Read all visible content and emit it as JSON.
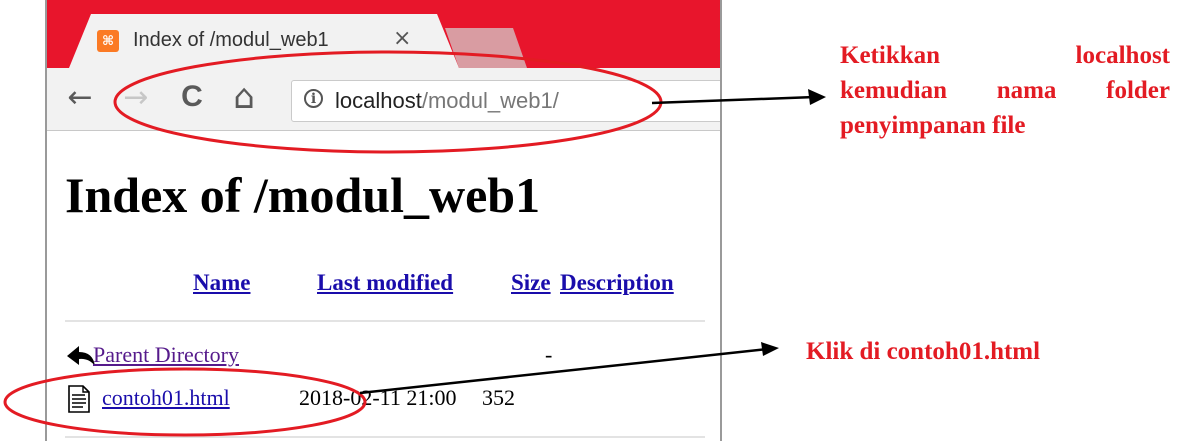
{
  "browser": {
    "tab": {
      "favicon_text": "⌘",
      "title": "Index of /modul_web1",
      "close_glyph": "×"
    },
    "toolbar": {
      "back_glyph": "←",
      "forward_glyph": "→",
      "reload_glyph": "C",
      "home_glyph": "⌂"
    },
    "address_bar": {
      "info_glyph": "i",
      "host": "localhost",
      "path": "/modul_web1/"
    }
  },
  "page": {
    "title": "Index of /modul_web1",
    "columns": [
      "Name",
      "Last modified",
      "Size",
      "Description"
    ],
    "rows": [
      {
        "name": "Parent Directory",
        "modified": "",
        "size": "-",
        "description": ""
      },
      {
        "name": "contoh01.html",
        "modified": "2018-02-11 21:00",
        "size": "352",
        "description": ""
      }
    ]
  },
  "annotations": {
    "callout_address": {
      "line1_a": "Ketikkan",
      "line1_b": "localhost",
      "line2": "kemudian nama folder",
      "line3": "penyimpanan file"
    },
    "callout_file": "Klik di contoh01.html",
    "color": "#e31b23"
  },
  "colors": {
    "tabstrip": "#e8152c",
    "favicon": "#fb7a24",
    "link": "#1a0dab",
    "visited_link": "#551a8b"
  }
}
